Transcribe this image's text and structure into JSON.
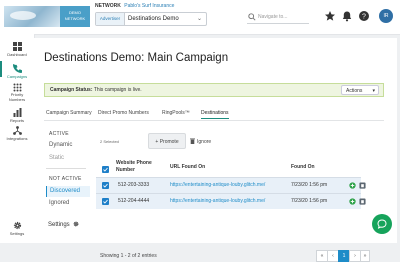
{
  "brand": {
    "logo_text": "DEMO NETWORK"
  },
  "header": {
    "network_label": "NETWORK",
    "network_value": "Pablo's Surf Insurance",
    "advertiser_label": "Advertiser",
    "advertiser_value": "Destinations Demo",
    "search_placeholder": "Navigate to...",
    "avatar_initials": "IR",
    "icons": [
      "star-icon",
      "bell-icon",
      "help-icon"
    ]
  },
  "sidenav": {
    "items": [
      {
        "label": "Dashboard",
        "icon": "dashboard-icon"
      },
      {
        "label": "Campaigns",
        "icon": "phone-icon",
        "active": true
      },
      {
        "label": "Priority Numbers",
        "icon": "keypad-icon"
      },
      {
        "label": "Reports",
        "icon": "bar-chart-icon"
      },
      {
        "label": "Integrations",
        "icon": "network-icon"
      },
      {
        "label": "Settings",
        "icon": "gear-icon"
      }
    ]
  },
  "page": {
    "title": "Destinations Demo: Main Campaign",
    "status_label": "Campaign Status:",
    "status_text": "This campaign is live.",
    "actions_label": "Actions",
    "tabs": [
      "Campaign Summary",
      "Direct Promo Numbers",
      "RingPools™",
      "Destinations"
    ]
  },
  "filter": {
    "active_heading": "ACTIVE",
    "active_items": [
      "Dynamic",
      "Static"
    ],
    "inactive_heading": "NOT ACTIVE",
    "inactive_items": [
      "Discovered",
      "Ignored"
    ],
    "settings_label": "Settings"
  },
  "toolbar": {
    "selected_text": "2 Selected",
    "promote_label": "Promote",
    "ignore_label": "Ignore"
  },
  "table": {
    "headers": [
      "Website Phone Number",
      "URL Found On",
      "Found On"
    ],
    "rows": [
      {
        "phone": "512-203-3333",
        "url": "https://entertaining-antique-louby.glitch.me/",
        "found_on": "7/23/20 1:56 pm"
      },
      {
        "phone": "512-204-4444",
        "url": "https://entertaining-antique-louby.glitch.me/",
        "found_on": "7/23/20 1:56 pm"
      }
    ],
    "footer_text": "Showing 1 - 2 of 2 entries",
    "pager": [
      "«",
      "‹",
      "1",
      "›",
      "»"
    ]
  },
  "colors": {
    "accent": "#1c8c7e",
    "link": "#1e8cc8",
    "chat": "#16a35b"
  }
}
